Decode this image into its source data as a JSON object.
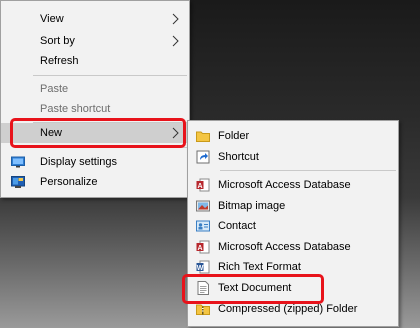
{
  "context_menu": {
    "view": "View",
    "sort_by": "Sort by",
    "refresh": "Refresh",
    "paste": "Paste",
    "paste_shortcut": "Paste shortcut",
    "new": "New",
    "display_settings": "Display settings",
    "personalize": "Personalize"
  },
  "new_submenu": {
    "folder": "Folder",
    "shortcut": "Shortcut",
    "items": [
      {
        "label": "Microsoft Access Database",
        "icon": "access-database-icon"
      },
      {
        "label": "Bitmap image",
        "icon": "bitmap-icon"
      },
      {
        "label": "Contact",
        "icon": "contact-icon"
      },
      {
        "label": "Microsoft Access Database",
        "icon": "access-database-icon"
      },
      {
        "label": "Rich Text Format",
        "icon": "rtf-icon"
      },
      {
        "label": "Text Document",
        "icon": "text-document-icon"
      },
      {
        "label": "Compressed (zipped) Folder",
        "icon": "zip-folder-icon"
      }
    ]
  },
  "colors": {
    "highlight_border": "#e8131b",
    "menu_bg": "#f2f2f2",
    "hover_bg": "#cfcfcf",
    "disabled_text": "#6d6d6d"
  }
}
